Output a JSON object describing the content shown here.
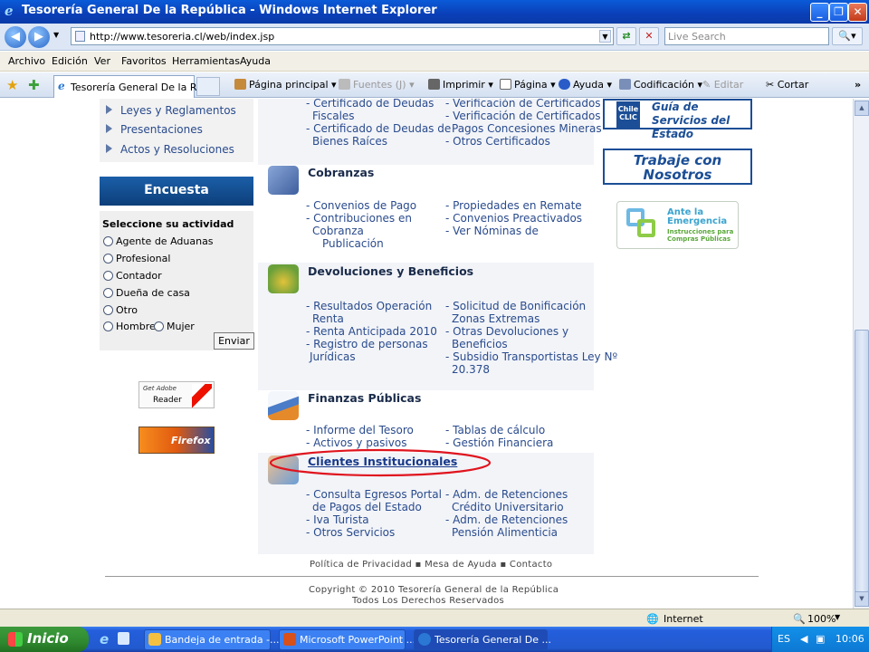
{
  "window": {
    "title": "Tesorería General De la República - Windows Internet Explorer"
  },
  "address_bar": {
    "url": "http://www.tesoreria.cl/web/index.jsp",
    "search_placeholder": "Live Search"
  },
  "menu": [
    "Archivo",
    "Edición",
    "Ver",
    "Favoritos",
    "Herramientas",
    "Ayuda"
  ],
  "tab": {
    "label": "Tesorería General De la R..."
  },
  "commands": {
    "home": "Página principal",
    "feeds": "Fuentes (J)",
    "print": "Imprimir",
    "page": "Página",
    "help": "Ayuda",
    "encoding": "Codificación",
    "edit": "Editar",
    "cut": "Cortar"
  },
  "left_nav": [
    "Leyes y Reglamentos",
    "Presentaciones",
    "Actos y Resoluciones"
  ],
  "survey": {
    "title": "Encuesta",
    "prompt": "Seleccione su actividad",
    "options": [
      "Agente de Aduanas",
      "Profesional",
      "Contador",
      "Dueña de casa",
      "Otro"
    ],
    "gender": [
      "Hombre",
      "Mujer"
    ],
    "submit": "Enviar"
  },
  "badges": {
    "adobe_get": "Get Adobe",
    "adobe_reader": "Reader",
    "firefox": "Firefox"
  },
  "sections": {
    "top": {
      "left": [
        "- Certificado de Deudas",
        "Fiscales",
        "- Certificado de Deudas de",
        "Bienes Raíces"
      ],
      "right": [
        "- Verificación de Certificados",
        "- Verificación de Certificados",
        "Pagos Concesiones Mineras",
        "- Otros Certificados"
      ]
    },
    "cobranzas": {
      "title": "Cobranzas",
      "left": [
        "- Convenios de Pago",
        "- Contribuciones en",
        "Cobranza",
        "Publicación"
      ],
      "right": [
        "- Propiedades en Remate",
        "- Convenios Preactivados",
        "- Ver Nóminas de"
      ]
    },
    "devoluciones": {
      "title": "Devoluciones y Beneficios",
      "left": [
        "- Resultados Operación",
        "Renta",
        "- Renta Anticipada 2010",
        "- Registro de personas",
        "Jurídicas"
      ],
      "right": [
        "- Solicitud de Bonificación",
        "Zonas Extremas",
        "- Otras Devoluciones y",
        "Beneficios",
        "- Subsidio Transportistas Ley Nº",
        "20.378"
      ]
    },
    "finanzas": {
      "title": "Finanzas Públicas",
      "left": [
        "- Informe del Tesoro",
        "- Activos y pasivos"
      ],
      "right": [
        "- Tablas de cálculo",
        "- Gestión Financiera"
      ]
    },
    "clientes": {
      "title": "Clientes Institucionales",
      "left": [
        "- Consulta Egresos Portal",
        "de Pagos del Estado",
        "- Iva Turista",
        "- Otros Servicios"
      ],
      "right": [
        "- Adm. de Retenciones",
        "Crédito Universitario",
        "- Adm. de Retenciones",
        "Pensión Alimenticia"
      ]
    }
  },
  "right_banners": {
    "guia_logo": "Chile CLIC",
    "guia": "Guía de Servicios del Estado",
    "trabaje": "Trabaje con Nosotros",
    "emergencia_title": "Ante la Emergencia",
    "emergencia_sub": "Instrucciones para Compras Públicas"
  },
  "footer": {
    "links": [
      "Política de Privacidad",
      "Mesa de Ayuda",
      "Contacto"
    ],
    "copyright": "Copyright © 2010 Tesorería General de la República",
    "rights": "Todos Los Derechos Reservados"
  },
  "status_bar": {
    "zone": "Internet",
    "zoom": "100%"
  },
  "taskbar": {
    "start": "Inicio",
    "tasks": [
      "Bandeja de entrada -...",
      "Microsoft PowerPoint ...",
      "Tesorería General De ..."
    ],
    "lang": "ES",
    "clock": "10:06"
  },
  "colors": {
    "link": "#2a4b8d",
    "highlight_ellipse": "#e0141e",
    "banner_blue": "#1b4e96"
  }
}
